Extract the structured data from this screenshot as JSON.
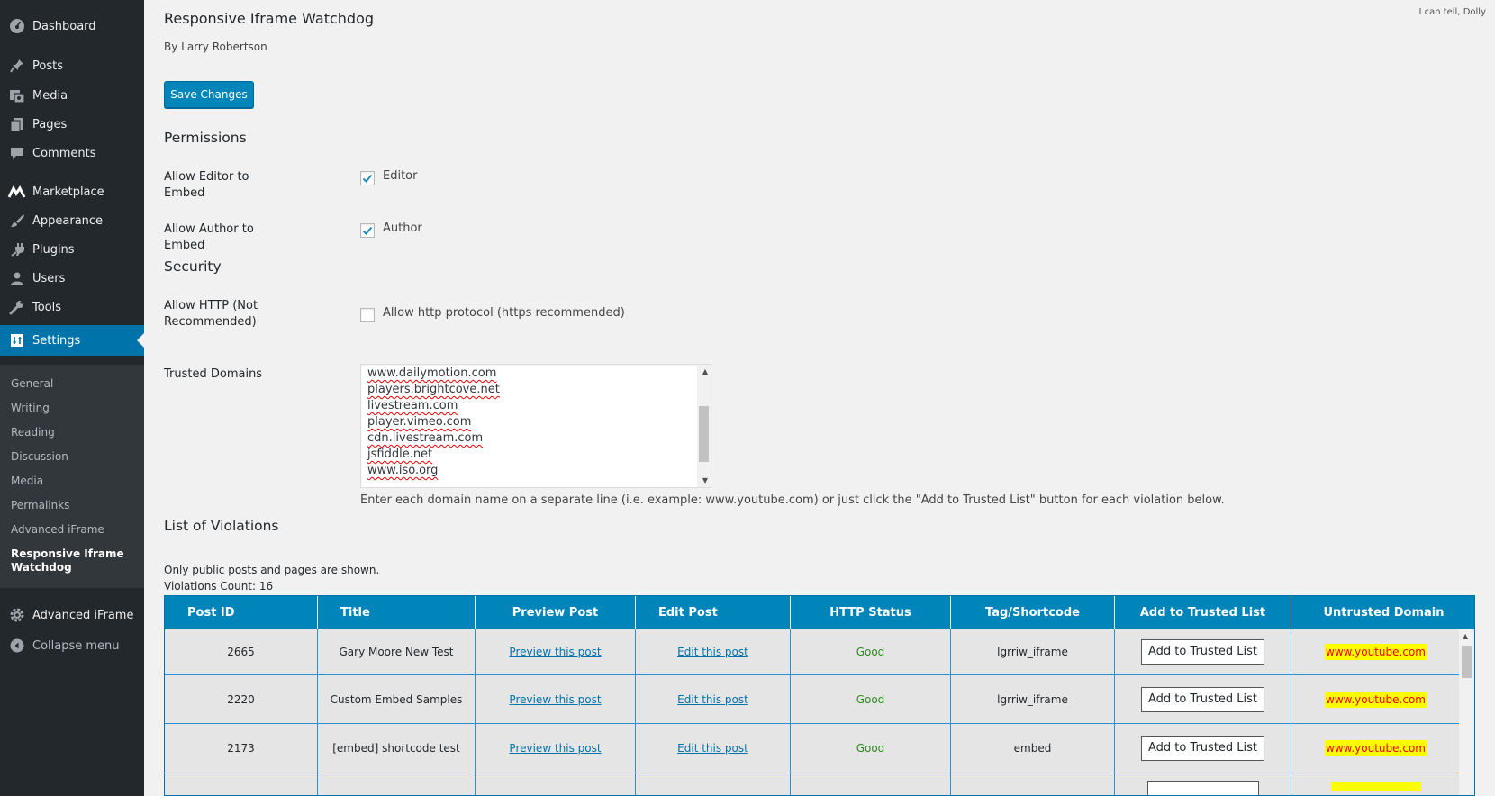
{
  "sidebar": {
    "items": [
      {
        "label": "Dashboard",
        "icon": "dashboard-icon"
      },
      {
        "label": "Posts",
        "icon": "pin-icon"
      },
      {
        "label": "Media",
        "icon": "media-icon"
      },
      {
        "label": "Pages",
        "icon": "pages-icon"
      },
      {
        "label": "Comments",
        "icon": "comment-icon"
      },
      {
        "label": "Marketplace",
        "icon": "marketplace-icon"
      },
      {
        "label": "Appearance",
        "icon": "brush-icon"
      },
      {
        "label": "Plugins",
        "icon": "plugin-icon"
      },
      {
        "label": "Users",
        "icon": "user-icon"
      },
      {
        "label": "Tools",
        "icon": "wrench-icon"
      },
      {
        "label": "Settings",
        "icon": "settings-icon"
      }
    ],
    "submenu": [
      "General",
      "Writing",
      "Reading",
      "Discussion",
      "Media",
      "Permalinks",
      "Advanced iFrame",
      "Responsive Iframe Watchdog"
    ],
    "advanced_iframe": "Advanced iFrame",
    "collapse": "Collapse menu",
    "accent": "#0073aa"
  },
  "header": {
    "dolly": "I can tell, Dolly",
    "title": "Responsive Iframe Watchdog",
    "author": "By Larry Robertson",
    "save_label": "Save Changes"
  },
  "permissions": {
    "title": "Permissions",
    "editor_label": "Allow Editor to Embed",
    "editor_cb": "Editor",
    "editor_checked": true,
    "author_label": "Allow Author to Embed",
    "author_cb": "Author",
    "author_checked": true
  },
  "security": {
    "title": "Security",
    "http_label": "Allow HTTP (Not Recommended)",
    "http_cb": "Allow http protocol (https recommended)",
    "http_checked": false,
    "trusted_label": "Trusted Domains",
    "domains": [
      "www.dailymotion.com",
      "players.brightcove.net",
      "livestream.com",
      "player.vimeo.com",
      "cdn.livestream.com",
      "jsfiddle.net",
      "www.iso.org"
    ],
    "help": "Enter each domain name on a separate line (i.e. example: www.youtube.com) or just click the \"Add to Trusted List\" button for each violation below."
  },
  "violations": {
    "title": "List of Violations",
    "note": "Only public posts and pages are shown.",
    "count": "Violations Count: 16",
    "columns": [
      "Post ID",
      "Title",
      "Preview Post",
      "Edit Post",
      "HTTP Status",
      "Tag/Shortcode",
      "Add to Trusted List",
      "Untrusted Domain"
    ],
    "rows": [
      {
        "id": "2665",
        "title": "Gary Moore New Test",
        "preview": "Preview this post",
        "edit": "Edit this post",
        "status": "Good",
        "tag": "lgrriw_iframe",
        "button": "Add to Trusted List",
        "domain": "www.youtube.com"
      },
      {
        "id": "2220",
        "title": "Custom Embed Samples",
        "preview": "Preview this post",
        "edit": "Edit this post",
        "status": "Good",
        "tag": "lgrriw_iframe",
        "button": "Add to Trusted List",
        "domain": "www.youtube.com"
      },
      {
        "id": "2173",
        "title": "[embed] shortcode test",
        "preview": "Preview this post",
        "edit": "Edit this post",
        "status": "Good",
        "tag": "embed",
        "button": "Add to Trusted List",
        "domain": "www.youtube.com"
      },
      {
        "id": "",
        "title": "",
        "preview": "",
        "edit": "",
        "status": "",
        "tag": "",
        "button": "",
        "domain": ""
      }
    ],
    "header_color": "#0085ba",
    "good_color": "#2e8b1f",
    "highlight_color": "#ffff00"
  }
}
